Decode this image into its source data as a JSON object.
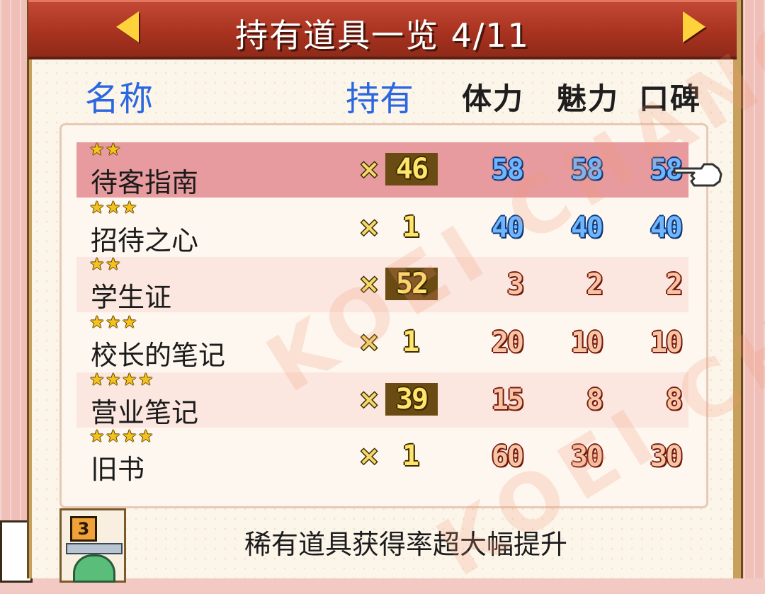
{
  "header": {
    "title": "持有道具一览 4/11",
    "prev_icon": "triangle-left",
    "next_icon": "triangle-right"
  },
  "columns": {
    "name": "名称",
    "owned": "持有",
    "stamina": "体力",
    "charm": "魅力",
    "reputation": "口碑"
  },
  "items": [
    {
      "stars": 2,
      "name": "待客指南",
      "x": "×",
      "qty": "46",
      "stamina": "58",
      "charm": "58",
      "reputation": "58",
      "color": "blue"
    },
    {
      "stars": 3,
      "name": "招待之心",
      "x": "×",
      "qty": "1",
      "stamina": "40",
      "charm": "40",
      "reputation": "40",
      "color": "blue"
    },
    {
      "stars": 2,
      "name": "学生证",
      "x": "×",
      "qty": "52",
      "stamina": "3",
      "charm": "2",
      "reputation": "2",
      "color": "red"
    },
    {
      "stars": 3,
      "name": "校长的笔记",
      "x": "×",
      "qty": "1",
      "stamina": "20",
      "charm": "10",
      "reputation": "10",
      "color": "red"
    },
    {
      "stars": 4,
      "name": "营业笔记",
      "x": "×",
      "qty": "39",
      "stamina": "15",
      "charm": "8",
      "reputation": "8",
      "color": "red"
    },
    {
      "stars": 4,
      "name": "旧书",
      "x": "×",
      "qty": "1",
      "stamina": "60",
      "charm": "30",
      "reputation": "30",
      "color": "red"
    }
  ],
  "footer": {
    "badge": "3",
    "description": "稀有道具获得率超大幅提升",
    "icon": "scale-icon"
  },
  "watermark": "KOEI CHANG",
  "colors": {
    "title_bar": "#a7321f",
    "accent_blue": "#2b67e0",
    "selected_row": "#e89b9e"
  }
}
